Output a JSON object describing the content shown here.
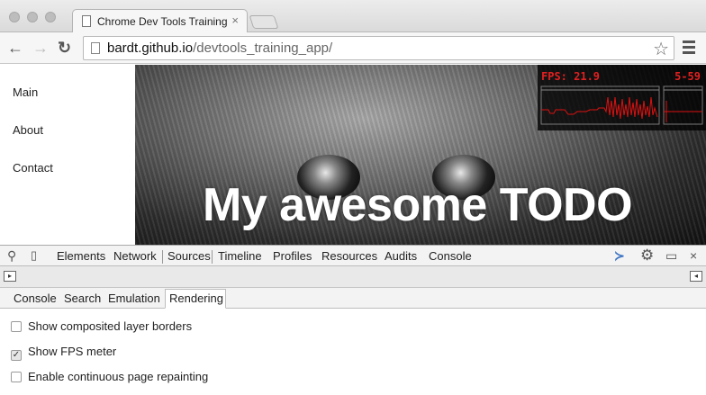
{
  "browser": {
    "tab_title": "Chrome Dev Tools Training",
    "tab_close": "×",
    "address_host": "bardt.github.io",
    "address_path": "/devtools_training_app/",
    "back": "←",
    "forward": "→",
    "reload": "↻",
    "star": "☆"
  },
  "page": {
    "nav": [
      "Main",
      "About",
      "Contact"
    ],
    "hero_title": "My awesome TODO"
  },
  "fps_meter": {
    "label": "FPS: 21.9",
    "range": "5-59",
    "color": "#e02020"
  },
  "devtools": {
    "tabs": [
      "Elements",
      "Network",
      "Sources",
      "Timeline",
      "Profiles",
      "Resources",
      "Audits",
      "Console"
    ],
    "active_tab": "Sources",
    "close": "×",
    "drawer_tabs": [
      "Console",
      "Search",
      "Emulation",
      "Rendering"
    ],
    "active_drawer_tab": "Rendering",
    "options": [
      {
        "label": "Show composited layer borders",
        "checked": false
      },
      {
        "label": "Show FPS meter",
        "checked": true
      },
      {
        "label": "Enable continuous page repainting",
        "checked": false
      }
    ],
    "check_mark": "✓"
  },
  "colors": {
    "devtools_accent": "#3b73c4"
  }
}
